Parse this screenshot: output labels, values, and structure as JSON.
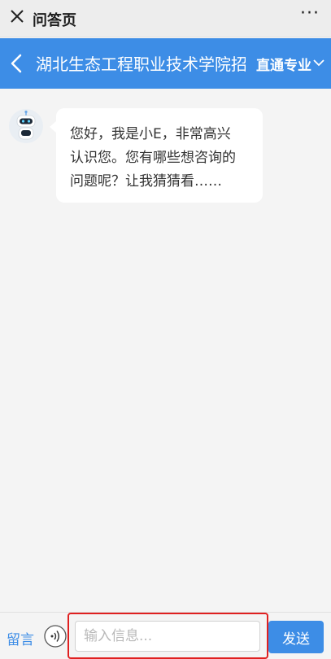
{
  "window": {
    "title": "问答页",
    "close_icon": "close-icon",
    "more_label": "···"
  },
  "header": {
    "title": "湖北生态工程职业技术学院招",
    "direct_label": "直通专业",
    "back_icon": "back-chevron-icon",
    "dropdown_icon": "chevron-down-icon",
    "background": "#3d8de6"
  },
  "chat": {
    "messages": [
      {
        "from": "bot",
        "avatar_icon": "robot-icon",
        "lines": [
          "您好，我是小E，非常高兴",
          "认识您。您有哪些想咨询的",
          "问题呢？让我猜猜看……"
        ]
      }
    ]
  },
  "input_bar": {
    "message_label": "留言",
    "voice_icon": "voice-icon",
    "placeholder": "输入信息...",
    "value": "",
    "send_label": "发送",
    "highlight_color": "#e02020"
  }
}
